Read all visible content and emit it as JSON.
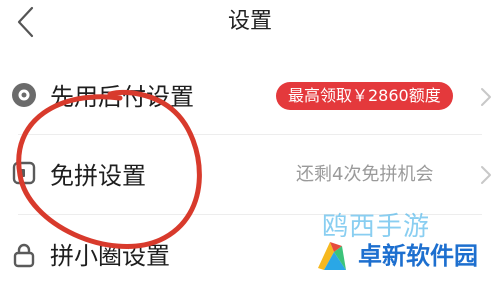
{
  "header": {
    "title": "设置",
    "back_icon": "chevron-left-icon"
  },
  "rows": [
    {
      "label": "先用后付设置",
      "icon": "settings-gear-icon",
      "badge": "最高领取￥2860额度",
      "badge_color": "#e4393c",
      "chevron": "chevron-right-icon"
    },
    {
      "label": "免拼设置",
      "icon": "wallet-card-icon",
      "value": "还剩4次免拼机会",
      "chevron": "chevron-right-icon"
    },
    {
      "label": "拼小圈设置",
      "icon": "lock-icon"
    }
  ],
  "annotation": {
    "shape": "ellipse",
    "color": "#d83a2c"
  },
  "watermark": {
    "faint_text": "鸥西手游",
    "brand_text": "卓新软件园",
    "brand_color": "#1d6fcf"
  }
}
